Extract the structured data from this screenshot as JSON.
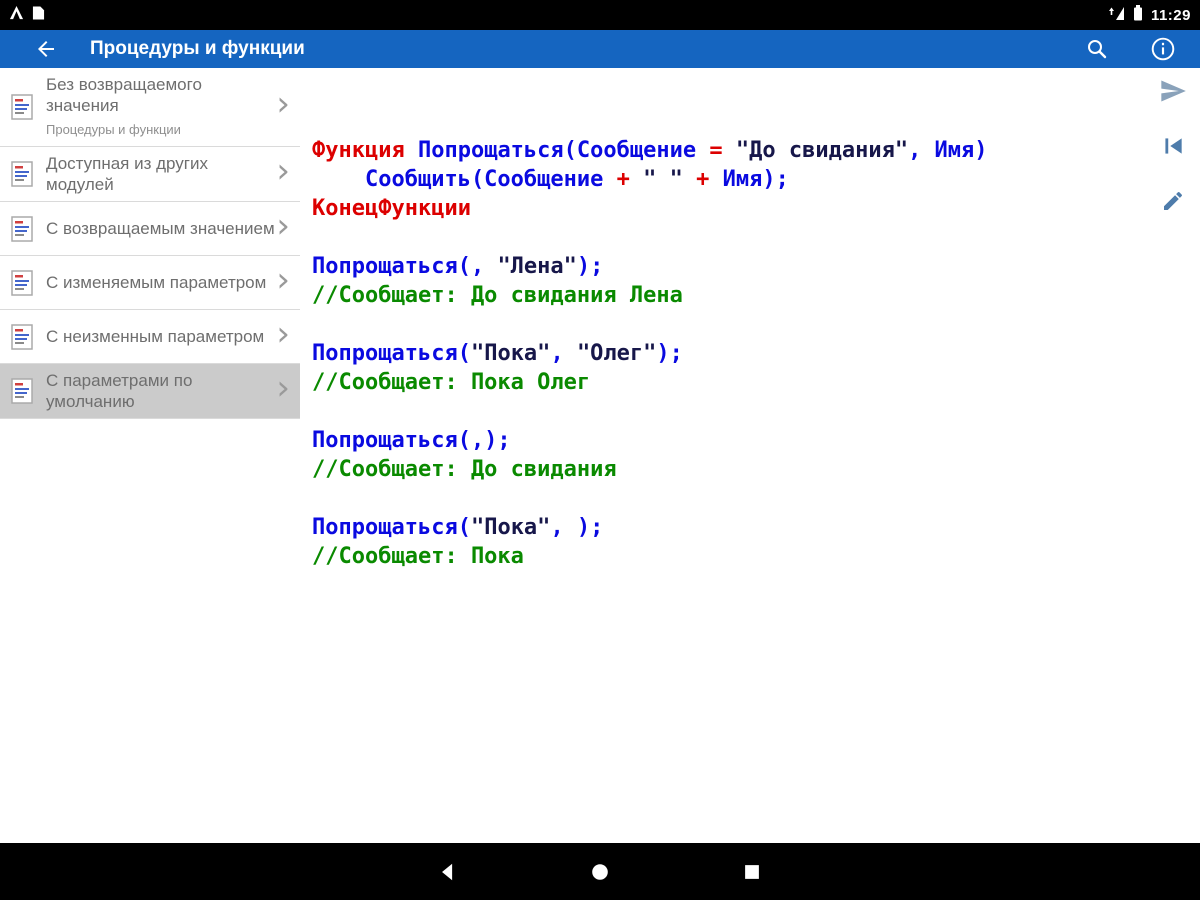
{
  "status_bar": {
    "time": "11:29"
  },
  "app_bar": {
    "title": "Процедуры и функции"
  },
  "icons": {
    "app_bar": [
      "back-arrow-icon",
      "search-icon",
      "info-icon"
    ],
    "status_left": [
      "app-notification-icon",
      "file-notification-icon"
    ],
    "status_right": [
      "network-signal-icon",
      "battery-icon"
    ],
    "content": [
      "send-icon",
      "skip-to-start-icon",
      "edit-icon"
    ],
    "sidebar": [
      "code-page-icon",
      "chevron-right-icon"
    ],
    "nav": [
      "nav-back-icon",
      "nav-home-icon",
      "nav-recents-icon"
    ]
  },
  "colors": {
    "app_bar": "#1565c0",
    "keyword": "#dc0000",
    "identifier": "#0a0ae0",
    "string": "#17174a",
    "comment": "#0a8a00",
    "selected_item_bg": "#cbcbcb"
  },
  "sidebar": {
    "items": [
      {
        "title": "Без возвращаемого значения",
        "subtitle": "Процедуры и функции",
        "selected": false
      },
      {
        "title": "Доступная из других модулей",
        "subtitle": "",
        "selected": false
      },
      {
        "title": "С возвращаемым значением",
        "subtitle": "",
        "selected": false
      },
      {
        "title": "С изменяемым параметром",
        "subtitle": "",
        "selected": false
      },
      {
        "title": "С неизменным параметром",
        "subtitle": "",
        "selected": false
      },
      {
        "title": "С параметрами по умолчанию",
        "subtitle": "",
        "selected": true
      }
    ]
  },
  "code": {
    "lines": [
      [
        {
          "c": "kw",
          "t": "Функция "
        },
        {
          "c": "id",
          "t": "Попрощаться(Сообщение "
        },
        {
          "c": "kw",
          "t": "= "
        },
        {
          "c": "str",
          "t": "\"До свидания\""
        },
        {
          "c": "id",
          "t": ", Имя)"
        }
      ],
      [
        {
          "c": "id",
          "t": "    Сообщить(Сообщение "
        },
        {
          "c": "kw",
          "t": "+"
        },
        {
          "c": "id",
          "t": " "
        },
        {
          "c": "str",
          "t": "\" \""
        },
        {
          "c": "id",
          "t": " "
        },
        {
          "c": "kw",
          "t": "+"
        },
        {
          "c": "id",
          "t": " Имя);"
        }
      ],
      [
        {
          "c": "kw",
          "t": "КонецФункции"
        }
      ],
      [],
      [
        {
          "c": "id",
          "t": "Попрощаться(, "
        },
        {
          "c": "str",
          "t": "\"Лена\""
        },
        {
          "c": "id",
          "t": ");"
        }
      ],
      [
        {
          "c": "com",
          "t": "//Сообщает: До свидания Лена"
        }
      ],
      [],
      [
        {
          "c": "id",
          "t": "Попрощаться("
        },
        {
          "c": "str",
          "t": "\"Пока\""
        },
        {
          "c": "id",
          "t": ", "
        },
        {
          "c": "str",
          "t": "\"Олег\""
        },
        {
          "c": "id",
          "t": ");"
        }
      ],
      [
        {
          "c": "com",
          "t": "//Сообщает: Пока Олег"
        }
      ],
      [],
      [
        {
          "c": "id",
          "t": "Попрощаться(,);"
        }
      ],
      [
        {
          "c": "com",
          "t": "//Сообщает: До свидания"
        }
      ],
      [],
      [
        {
          "c": "id",
          "t": "Попрощаться("
        },
        {
          "c": "str",
          "t": "\"Пока\""
        },
        {
          "c": "id",
          "t": ", );"
        }
      ],
      [
        {
          "c": "com",
          "t": "//Сообщает: Пока"
        }
      ]
    ]
  }
}
